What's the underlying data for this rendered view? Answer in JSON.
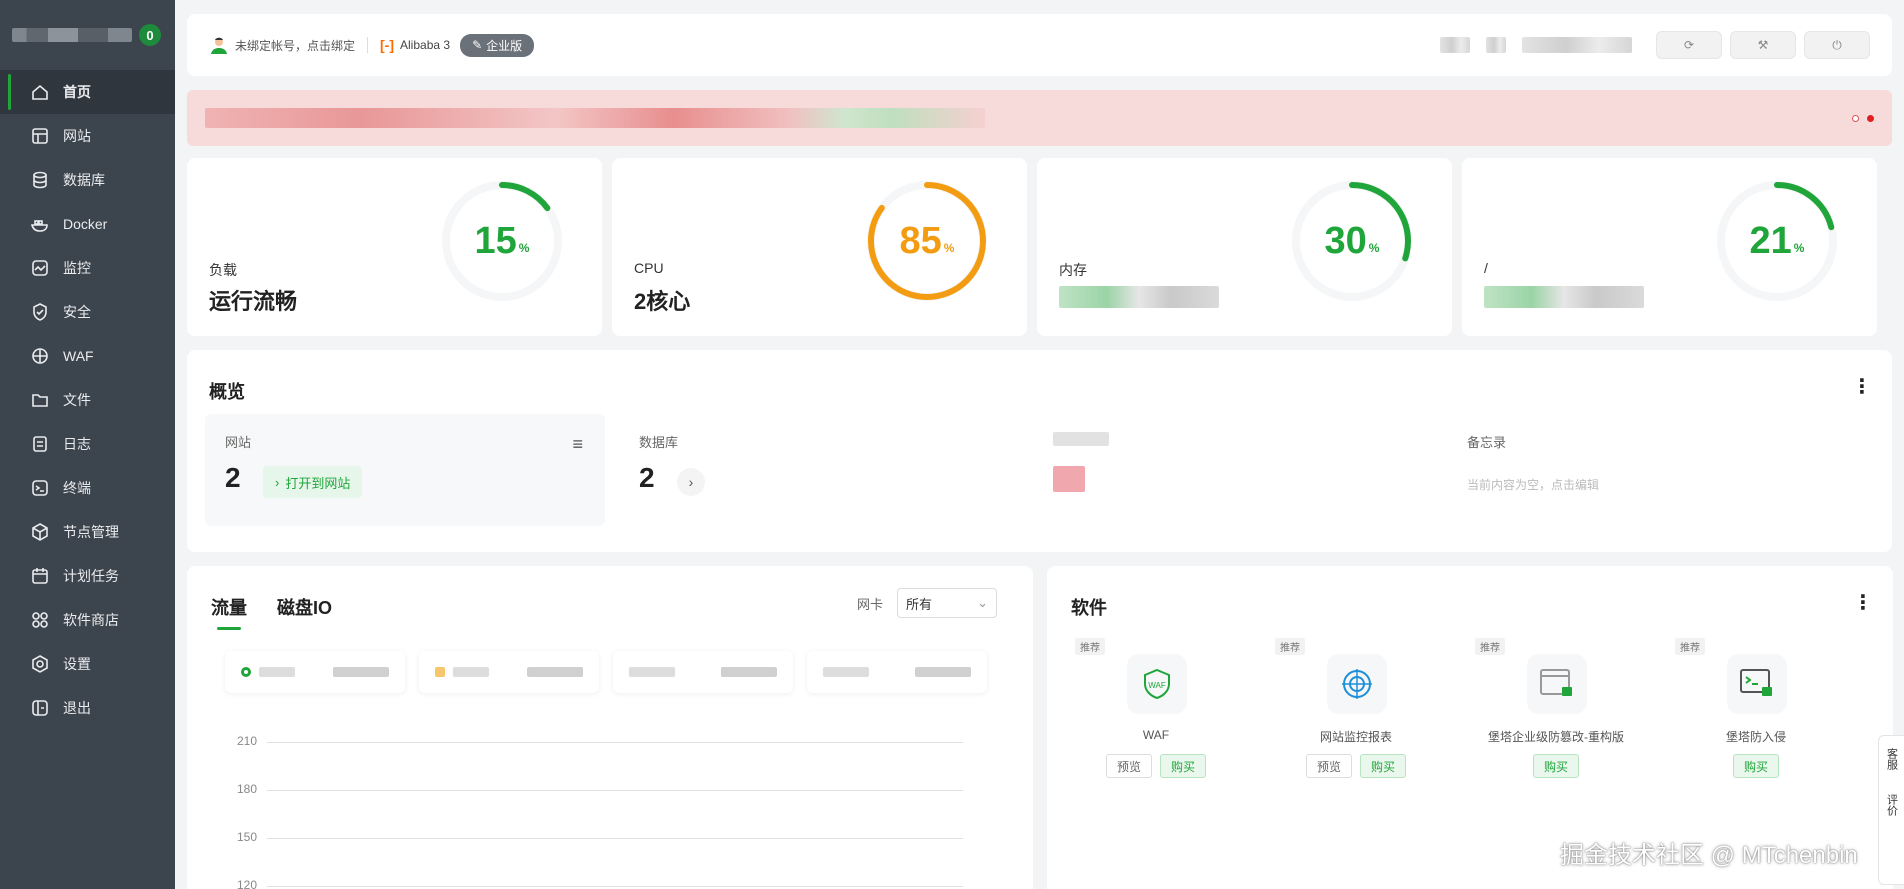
{
  "sidebar": {
    "badge": "0",
    "items": [
      {
        "label": "首页",
        "icon": "home-icon",
        "active": true
      },
      {
        "label": "网站",
        "icon": "website-icon"
      },
      {
        "label": "数据库",
        "icon": "database-icon"
      },
      {
        "label": "Docker",
        "icon": "docker-icon"
      },
      {
        "label": "监控",
        "icon": "monitor-icon"
      },
      {
        "label": "安全",
        "icon": "shield-icon"
      },
      {
        "label": "WAF",
        "icon": "waf-icon"
      },
      {
        "label": "文件",
        "icon": "folder-icon"
      },
      {
        "label": "日志",
        "icon": "log-icon"
      },
      {
        "label": "终端",
        "icon": "terminal-icon"
      },
      {
        "label": "节点管理",
        "icon": "node-icon"
      },
      {
        "label": "计划任务",
        "icon": "calendar-icon"
      },
      {
        "label": "软件商店",
        "icon": "store-icon"
      },
      {
        "label": "设置",
        "icon": "settings-icon"
      },
      {
        "label": "退出",
        "icon": "logout-icon"
      }
    ]
  },
  "topbar": {
    "bind_account": "未绑定帐号，点击绑定",
    "os": "Alibaba 3",
    "edition": "企业版"
  },
  "stats": [
    {
      "label": "负载",
      "value": "运行流畅",
      "percent": 15,
      "color": "#20a53a"
    },
    {
      "label": "CPU",
      "value": "2核心",
      "percent": 85,
      "color": "#f39c12"
    },
    {
      "label": "内存",
      "value": "",
      "percent": 30,
      "color": "#20a53a"
    },
    {
      "label": "/",
      "value": "",
      "percent": 21,
      "color": "#20a53a"
    }
  ],
  "overview": {
    "title": "概览",
    "website": {
      "label": "网站",
      "count": "2",
      "open_label": "打开到网站"
    },
    "database": {
      "label": "数据库",
      "count": "2"
    },
    "memo": {
      "label": "备忘录",
      "placeholder": "当前内容为空，点击编辑"
    }
  },
  "traffic": {
    "tabs": [
      "流量",
      "磁盘IO"
    ],
    "nic_label": "网卡",
    "nic_value": "所有",
    "y_ticks": [
      "210",
      "180",
      "150",
      "120"
    ]
  },
  "software": {
    "title": "软件",
    "tag": "推荐",
    "preview_label": "预览",
    "buy_label": "购买",
    "items": [
      {
        "name": "WAF",
        "icon": "waf-shield-icon",
        "has_preview": true
      },
      {
        "name": "网站监控报表",
        "icon": "radar-icon",
        "has_preview": true
      },
      {
        "name": "堡塔企业级防篡改-重构版",
        "icon": "browser-lock-icon",
        "has_preview": false
      },
      {
        "name": "堡塔防入侵",
        "icon": "terminal-lock-icon",
        "has_preview": false
      }
    ]
  },
  "watermark": "掘金技术社区 @ MTchenbin",
  "float_service": [
    "客服",
    "评价"
  ]
}
